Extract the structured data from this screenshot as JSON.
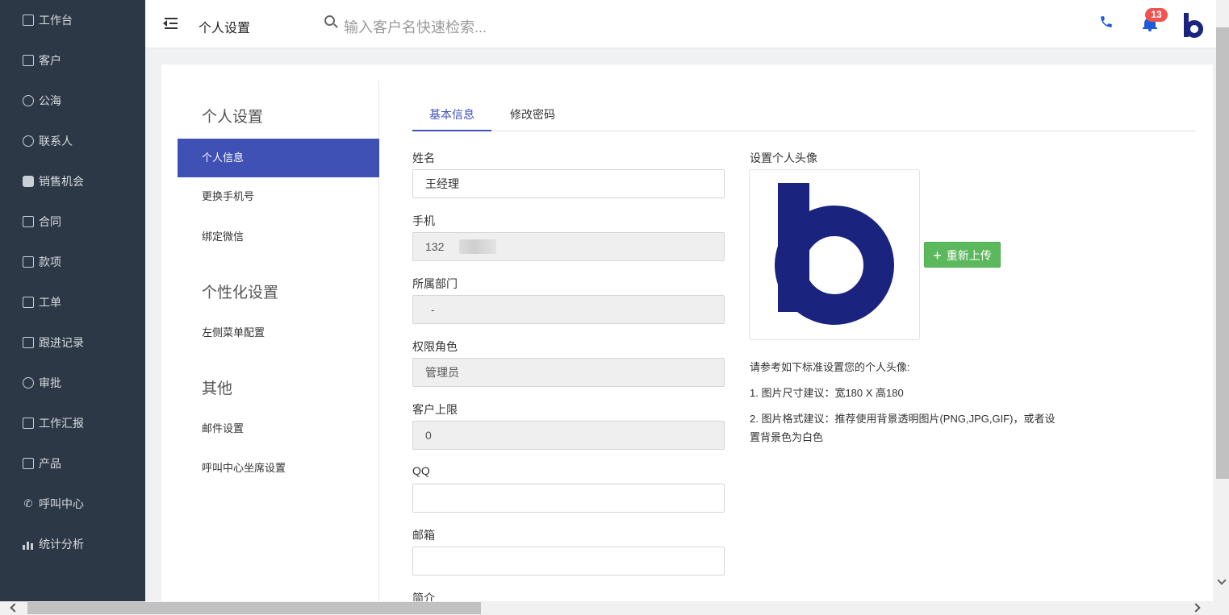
{
  "sidebar": {
    "items": [
      {
        "label": "工作台",
        "icon": "monitor-icon"
      },
      {
        "label": "客户",
        "icon": "building-icon"
      },
      {
        "label": "公海",
        "icon": "basket-icon"
      },
      {
        "label": "联系人",
        "icon": "person-icon"
      },
      {
        "label": "销售机会",
        "icon": "money-bag-icon"
      },
      {
        "label": "合同",
        "icon": "contract-icon"
      },
      {
        "label": "款项",
        "icon": "payment-icon"
      },
      {
        "label": "工单",
        "icon": "ticket-icon"
      },
      {
        "label": "跟进记录",
        "icon": "edit-icon"
      },
      {
        "label": "审批",
        "icon": "stamp-icon"
      },
      {
        "label": "工作汇报",
        "icon": "presentation-icon"
      },
      {
        "label": "产品",
        "icon": "grid-icon"
      },
      {
        "label": "呼叫中心",
        "icon": "phone-icon"
      },
      {
        "label": "统计分析",
        "icon": "bar-chart-icon"
      }
    ]
  },
  "header": {
    "title": "个人设置",
    "search_placeholder": "输入客户名快速检索...",
    "notification_count": "13",
    "accent_color": "#1e5bd8"
  },
  "settings_nav": {
    "section1_title": "个人设置",
    "section1_items": [
      "个人信息",
      "更换手机号",
      "绑定微信"
    ],
    "section2_title": "个性化设置",
    "section2_items": [
      "左侧菜单配置"
    ],
    "section3_title": "其他",
    "section3_items": [
      "邮件设置",
      "呼叫中心坐席设置"
    ],
    "active_color": "#3f51b5"
  },
  "tabs": [
    {
      "label": "基本信息",
      "active": true
    },
    {
      "label": "修改密码",
      "active": false
    }
  ],
  "form": {
    "name_label": "姓名",
    "name_value": "王经理",
    "phone_label": "手机",
    "phone_value": "132",
    "dept_label": "所属部门",
    "dept_value": "-",
    "role_label": "权限角色",
    "role_value": "管理员",
    "limit_label": "客户上限",
    "limit_value": "0",
    "qq_label": "QQ",
    "qq_value": "",
    "email_label": "邮箱",
    "email_value": "",
    "intro_label": "简介"
  },
  "avatar": {
    "label": "设置个人头像",
    "upload_button": "重新上传",
    "button_color": "#5cb85c",
    "logo_color": "#1a237e",
    "tips_title": "请参考如下标准设置您的个人头像:",
    "tip1": "1. 图片尺寸建议：宽180 X 高180",
    "tip2": "2. 图片格式建议：推荐使用背景透明图片(PNG,JPG,GIF)，或者设置背景色为白色"
  }
}
